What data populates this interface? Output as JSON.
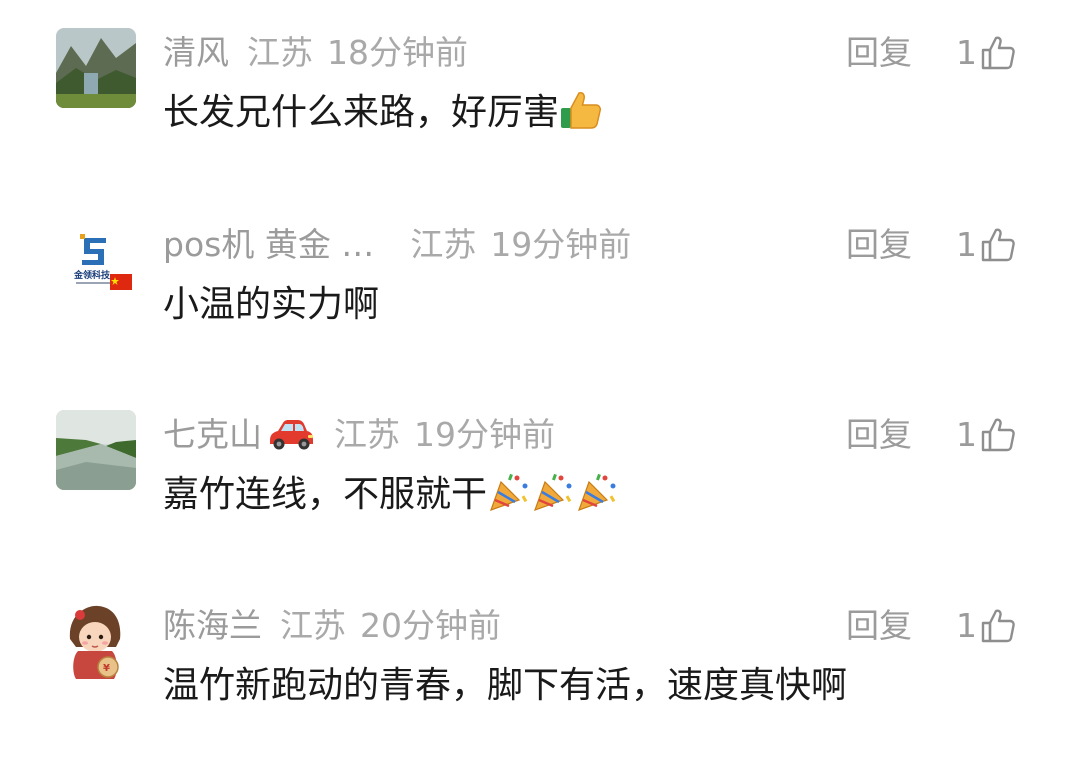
{
  "comments": [
    {
      "name": "清风",
      "location": "江苏",
      "time": "18分钟前",
      "reply_label": "回复",
      "likes": "1",
      "text": "长发兄什么来路，好厉害",
      "text_emoji": "thumbs-up-emoji",
      "avatar": "landscape-mountain-avatar"
    },
    {
      "name": "pos机 黄金 …",
      "location": "江苏",
      "time": "19分钟前",
      "reply_label": "回复",
      "likes": "1",
      "text": "小温的实力啊",
      "avatar": "company-logo-avatar",
      "avatar_text": "金领科技"
    },
    {
      "name": "七克山",
      "name_emoji": "car-emoji",
      "location": "江苏",
      "time": "19分钟前",
      "reply_label": "回复",
      "likes": "1",
      "text": "嘉竹连线，不服就干",
      "text_emoji": "party-popper-emoji",
      "avatar": "river-landscape-avatar"
    },
    {
      "name": "陈海兰",
      "location": "江苏",
      "time": "20分钟前",
      "reply_label": "回复",
      "likes": "1",
      "text": "温竹新跑动的青春，脚下有活，速度真快啊",
      "avatar": "cartoon-girl-avatar"
    }
  ],
  "colors": {
    "meta": "#9b9b9b",
    "text": "#1a1a1a",
    "background": "#ffffff"
  }
}
